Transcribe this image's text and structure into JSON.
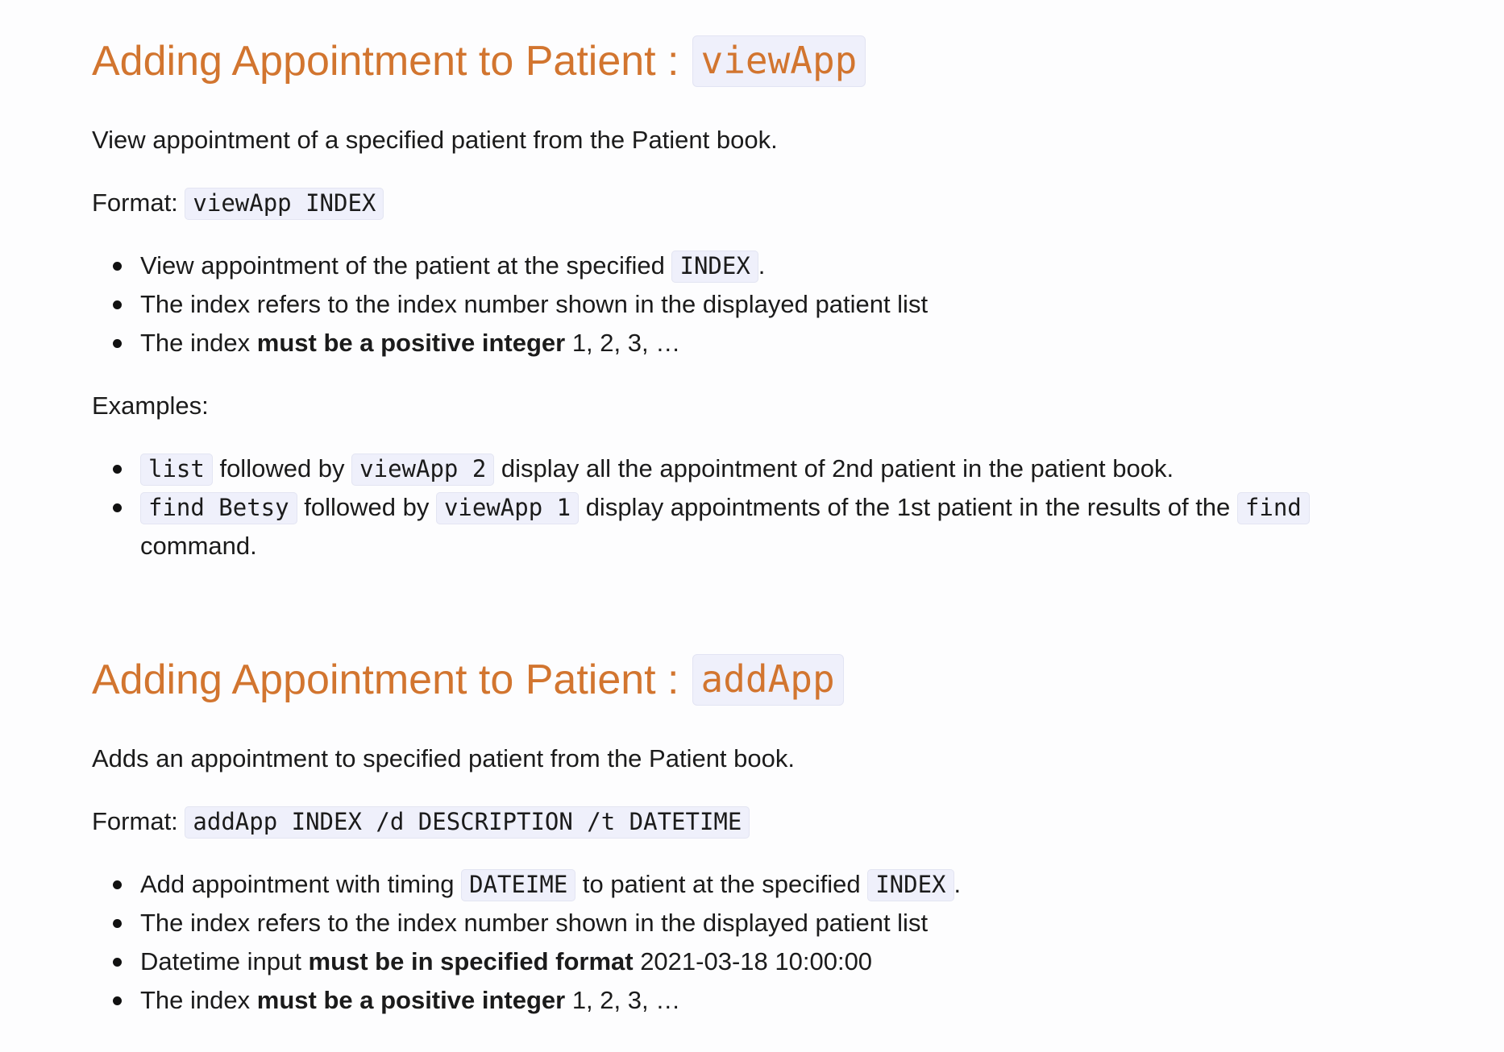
{
  "sections": [
    {
      "heading": {
        "text": "Adding Appointment to Patient :",
        "code": "viewApp"
      },
      "description": "View appointment of a specified patient from the Patient book.",
      "format": {
        "label": "Format:",
        "code": "viewApp INDEX"
      },
      "bullets": {
        "b1": {
          "pre": "View appointment of the patient at the specified ",
          "code": "INDEX",
          "post": "."
        },
        "b2": {
          "text": "The index refers to the index number shown in the displayed patient list"
        },
        "b3": {
          "pre": "The index ",
          "bold": "must be a positive integer",
          "post": " 1, 2, 3, …"
        }
      },
      "examples_label": "Examples:",
      "examples": {
        "e1": {
          "code1": "list",
          "mid": " followed by ",
          "code2": "viewApp 2",
          "post": " display all the appointment of 2nd patient in the patient book."
        },
        "e2": {
          "code1": "find Betsy",
          "mid": " followed by ",
          "code2": "viewApp 1",
          "post": " display appointments of the 1st patient in the results of the ",
          "code3": "find",
          "end": " command."
        }
      }
    },
    {
      "heading": {
        "text": "Adding Appointment to Patient :",
        "code": "addApp"
      },
      "description": "Adds an appointment to specified patient from the Patient book.",
      "format": {
        "label": "Format:",
        "code": "addApp INDEX /d DESCRIPTION /t DATETIME"
      },
      "bullets": {
        "b1": {
          "pre": "Add appointment with timing ",
          "code1": "DATEIME",
          "mid": " to patient at the specified ",
          "code2": "INDEX",
          "post": "."
        },
        "b2": {
          "text": "The index refers to the index number shown in the displayed patient list"
        },
        "b3": {
          "pre": "Datetime input ",
          "bold": "must be in specified format",
          "post": " 2021-03-18 10:00:00"
        },
        "b4": {
          "pre": "The index ",
          "bold": "must be a positive integer",
          "post": " 1, 2, 3, …"
        }
      }
    }
  ],
  "colors": {
    "heading": "#d2752f",
    "code_bg": "#eff0fb",
    "text": "#1b1b1b"
  }
}
